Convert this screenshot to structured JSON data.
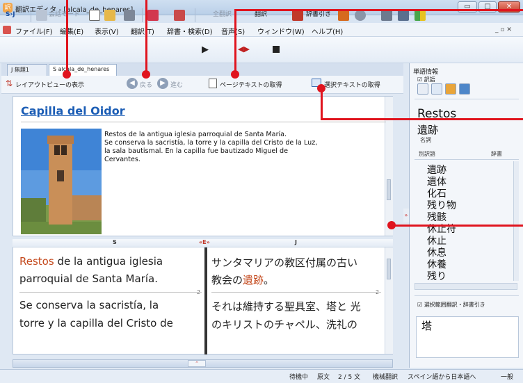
{
  "window": {
    "title": "翻訳エディタ - [alcala_de_henares]",
    "min_label": "▭",
    "max_label": "□",
    "close_label": "✕"
  },
  "menu": [
    "ファイル(F)",
    "編集(E)",
    "表示(V)",
    "翻訳(T)",
    "辞書・検索(D)",
    "音声(S)",
    "ウィンドウ(W)",
    "ヘルプ(H)"
  ],
  "toolbar": {
    "lang_pair": "S›J",
    "mode_label": "会話モード",
    "all_translate_label": "全翻訳",
    "translate_label": "翻訳",
    "dictionary_label": "辞書引き"
  },
  "tabs": [
    {
      "label": "J 無題1"
    },
    {
      "label": "S alcala_de_henares"
    }
  ],
  "layout_toolbar": {
    "layout_view": "レイアウトビューの表示",
    "back": "戻る",
    "forward": "進む",
    "page_text": "ページテキストの取得",
    "selected_text": "選択テキストの取得"
  },
  "web": {
    "title": "Capilla del Oidor",
    "paragraph": "Restos de la antigua iglesia parroquial de Santa María.\nSe conserva la sacristía, la torre y la capilla del Cristo de la Luz,\nla sala bautismal. En la capilla fue bautizado Miguel de\nCervantes."
  },
  "parallel": {
    "source_header": "S",
    "swap_header": "«E»",
    "target_header": "J",
    "rows": [
      {
        "num": "2",
        "src_hl": "Restos",
        "src_line1_rest": " de la antigua iglesia",
        "src_line2": "parroquial de Santa María.",
        "tgt_line1": "サンタマリアの教区付属の古い",
        "tgt_line2_pre": "教会の",
        "tgt_hl": "遺跡",
        "tgt_line2_post": "。"
      },
      {
        "num": "2",
        "src_line1": "Se conserva la sacristía, la",
        "src_line2": "torre y la capilla del Cristo de",
        "tgt_line1": "それは維持する聖具室、塔と 光",
        "tgt_line2": "のキリストのチャペル、洗礼の"
      }
    ]
  },
  "status": {
    "state": "待機中",
    "text_mode": "原文",
    "sentence_pos": "2 / 5 文",
    "dictionary": "機械翻訳",
    "direction": "スペイン語から日本語へ",
    "domain": "一般"
  },
  "word_panel": {
    "header": "単語情報",
    "checkbox_label": "訳語",
    "word": "Restos",
    "translation": "遺跡",
    "pos": "名詞",
    "col_alternatives": "別訳語",
    "col_dictionary": "辞書",
    "alternatives": [
      "遺跡",
      "遺体",
      "化石",
      "残り物",
      "残骸",
      "休止符",
      "休止",
      "休息",
      "休養",
      "残り"
    ],
    "range_checkbox_label": "選択範囲翻訳・辞書引き",
    "input_value": "塔"
  },
  "colors": {
    "highlight": "#c44a1e",
    "link": "#1b5db5",
    "callout": "#e0141e"
  }
}
